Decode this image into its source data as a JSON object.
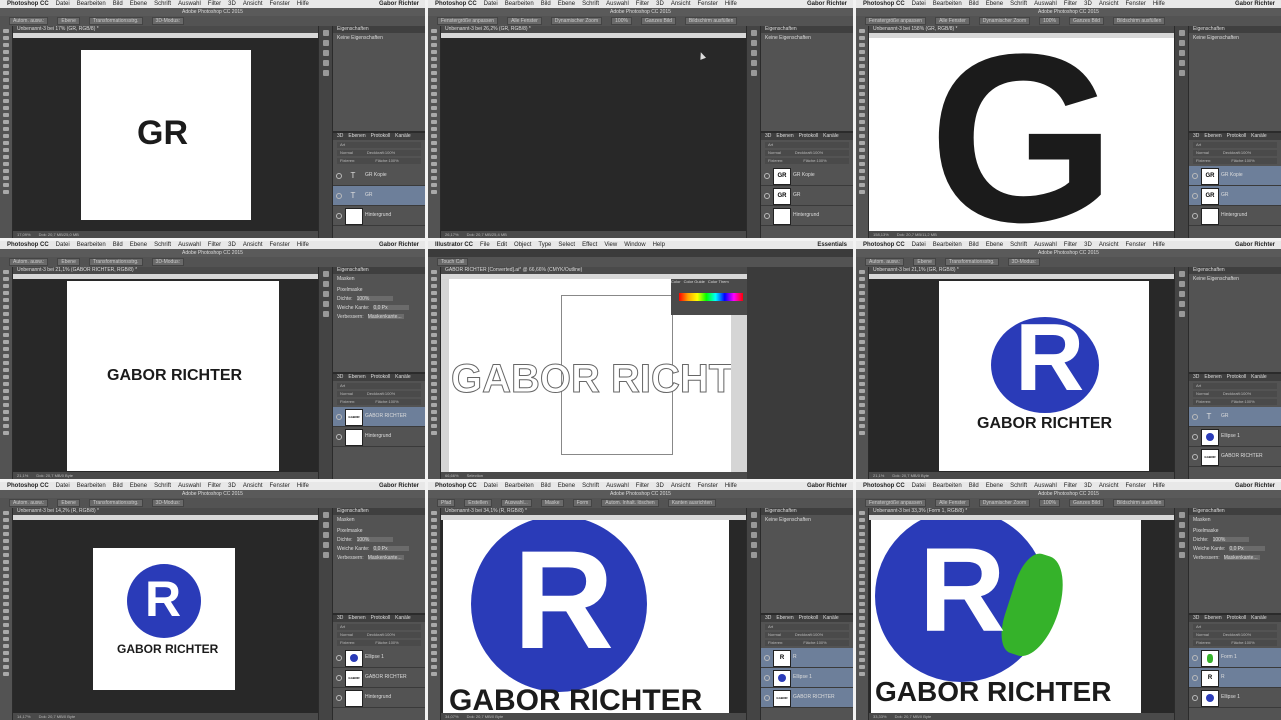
{
  "colors": {
    "accent_blue": "#2a3bb8",
    "accent_green": "#35b22a",
    "ui_dark": "#535353",
    "selection": "#6d7f9a"
  },
  "mac_menu": {
    "app": "Photoshop CC",
    "items": [
      "Datei",
      "Bearbeiten",
      "Bild",
      "Ebene",
      "Schrift",
      "Auswahl",
      "Filter",
      "3D",
      "Ansicht",
      "Fenster",
      "Hilfe"
    ],
    "user": "Gabor Richter"
  },
  "illustrator_menu": {
    "app": "Illustrator CC",
    "items": [
      "File",
      "Edit",
      "Object",
      "Type",
      "Select",
      "Effect",
      "View",
      "Window",
      "Help"
    ],
    "workspace": "Essentials"
  },
  "ps_window_title": "Adobe Photoshop CC 2015",
  "ps_options": {
    "auto": "Autom. ausw.:",
    "group": "Ebene",
    "transform": "Transformationsstrg.",
    "fit": "Fenstergröße anpassen",
    "all": "Alle Fenster",
    "dynzoom": "Dynamischer Zoom",
    "zoom100": "100%",
    "fullimg": "Ganzes Bild",
    "fillscreen": "Bildschirm ausfüllen",
    "mode3d": "3D-Modus:"
  },
  "properties": {
    "title": "Eigenschaften",
    "none": "Keine Eigenschaften",
    "masks": "Masken",
    "pixmask": "Pixelmaske",
    "density_label": "Dichte:",
    "density": "100%",
    "feather_label": "Weiche Kante:",
    "feather": "0,0 Px",
    "refine": "Verbessern:",
    "maskedge": "Maskenkante..."
  },
  "layers_panel": {
    "tabs": [
      "3D",
      "Ebenen",
      "Protokoll",
      "Kanäle"
    ],
    "kind": "Art",
    "blend": "Normal",
    "opacity_label": "Deckkraft:",
    "opacity": "100%",
    "fix_label": "Fixieren:",
    "fill_label": "Fläche:",
    "fill": "100%"
  },
  "panes": [
    {
      "doc_tab": "Unbenannt-3 bei 17% (GR, RGB/8) *",
      "status_zoom": "17,09%",
      "status_doc": "Dok: 20,7 MB/25,0 MB",
      "logo_text": "GR",
      "layers": [
        {
          "name": "GR Kopie"
        },
        {
          "name": "GR"
        },
        {
          "name": "Hintergrund"
        }
      ]
    },
    {
      "doc_tab": "Unbenannt-3 bei 26,2% (GR, RGB/8) *",
      "status_zoom": "26,17%",
      "status_doc": "Dok: 20,7 MB/25,4 MB",
      "layers": [
        {
          "name": "GR Kopie"
        },
        {
          "name": "GR"
        },
        {
          "name": "Hintergrund"
        }
      ]
    },
    {
      "doc_tab": "Unbenannt-3 bei 158% (GR, RGB/8) *",
      "status_zoom": "158,13%",
      "status_doc": "Dok: 20,7 MB/11,2 MB",
      "logo_text": "G",
      "layers": [
        {
          "name": "GR Kopie"
        },
        {
          "name": "GR"
        },
        {
          "name": "Hintergrund"
        }
      ]
    },
    {
      "doc_tab": "Unbenannt-3 bei 21,1% (GABOR RICHTER, RGB/8) *",
      "status_zoom": "21,1%",
      "status_doc": "Dok: 20,7 MB/0 Byte",
      "logo_text": "GABOR RICHTER",
      "layers": [
        {
          "name": "GABOR RICHTER"
        },
        {
          "name": "Hintergrund"
        }
      ]
    },
    {
      "doc_tab": "GABOR RICHTER [Converted].ai* @ 66,66% (CMYK/Outline)",
      "status_zoom": "66,66%",
      "status_doc": "Selection",
      "logo_text": "GABOR RICHTER",
      "swatch_panel": [
        "Color",
        "Color Guide",
        "Color Them"
      ],
      "brush": "Touch Call"
    },
    {
      "doc_tab": "Unbenannt-3 bei 21,1% (GR, RGB/8) *",
      "status_zoom": "21,1%",
      "status_doc": "Dok: 20,7 MB/0 Byte",
      "logo_text": "GABOR RICHTER",
      "logo_letter": "R",
      "layers": [
        {
          "name": "GR"
        },
        {
          "name": "Ellipse 1"
        },
        {
          "name": "GABOR RICHTER"
        }
      ]
    },
    {
      "doc_tab": "Unbenannt-3 bei 14,2% (R, RGB/8) *",
      "status_zoom": "14,17%",
      "status_doc": "Dok: 20,7 MB/0 Byte",
      "logo_text": "GABOR RICHTER",
      "logo_letter": "R",
      "layers": [
        {
          "name": "Ellipse 1"
        },
        {
          "name": "GABOR RICHTER"
        },
        {
          "name": "Hintergrund"
        }
      ]
    },
    {
      "doc_tab": "Unbenannt-3 bei 34,1% (R, RGB/8) *",
      "status_zoom": "34,07%",
      "status_doc": "Dok: 20,7 MB/0 Byte",
      "logo_text": "GABOR RICHTER",
      "logo_letter": "R",
      "options": {
        "mode": "Pfad",
        "make": "Erstellen",
        "sel": "Auswahl...",
        "mask": "Maske",
        "form": "Form",
        "align": "Autom. Inhalt. löschen",
        "edge": "Kanten ausrichten"
      },
      "layers": [
        {
          "name": "R"
        },
        {
          "name": "Ellipse 1"
        },
        {
          "name": "GABOR RICHTER"
        }
      ]
    },
    {
      "doc_tab": "Unbenannt-3 bei 33,3% (Form 1, RGB/8) *",
      "status_zoom": "33,33%",
      "status_doc": "Dok: 20,7 MB/0 Byte",
      "logo_text": "GABOR RICHTER",
      "logo_letter": "R",
      "layers": [
        {
          "name": "Form 1"
        },
        {
          "name": "R"
        },
        {
          "name": "Ellipse 1"
        }
      ]
    }
  ]
}
